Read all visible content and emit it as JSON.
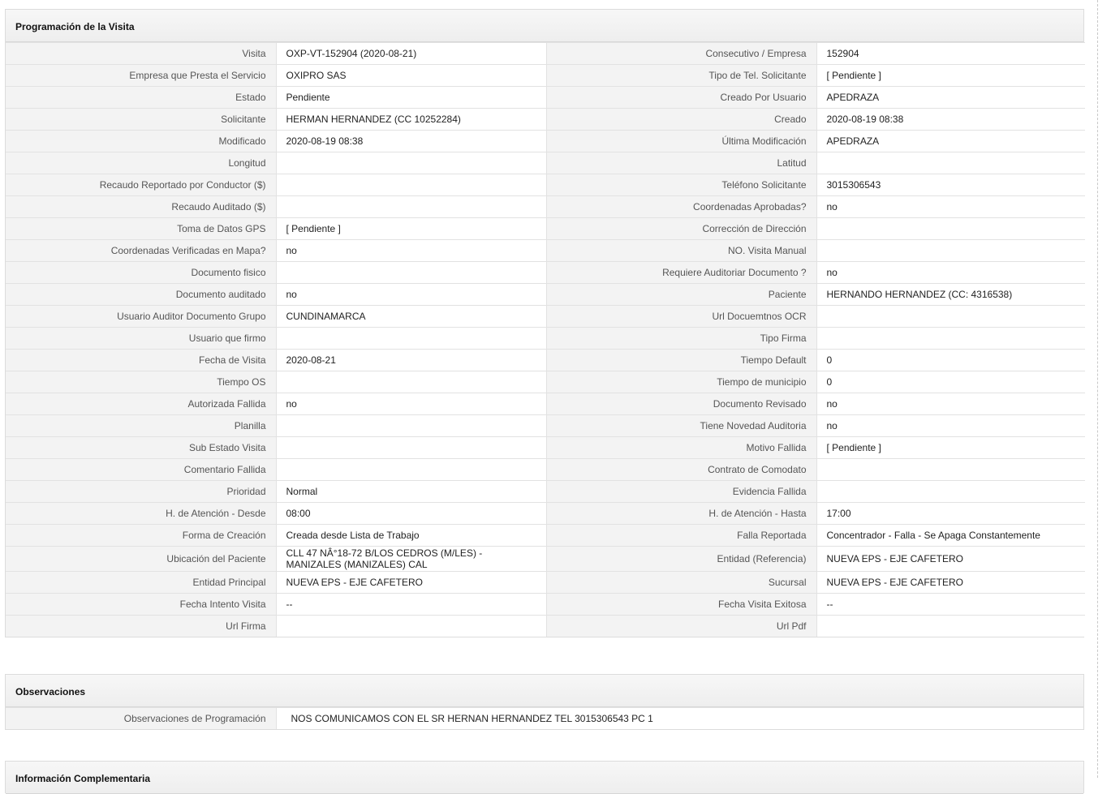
{
  "visit_section": {
    "title": "Programación de la Visita",
    "rows": [
      {
        "l1": "Visita",
        "v1": "OXP-VT-152904 (2020-08-21)",
        "l2": "Consecutivo / Empresa",
        "v2": "152904"
      },
      {
        "l1": "Empresa que Presta el Servicio",
        "v1": "OXIPRO SAS",
        "l2": "Tipo de Tel. Solicitante",
        "v2": "[ Pendiente ]"
      },
      {
        "l1": "Estado",
        "v1": "Pendiente",
        "l2": "Creado Por Usuario",
        "v2": "APEDRAZA"
      },
      {
        "l1": "Solicitante",
        "v1": "HERMAN HERNANDEZ (CC 10252284)",
        "l2": "Creado",
        "v2": "2020-08-19 08:38"
      },
      {
        "l1": "Modificado",
        "v1": "2020-08-19 08:38",
        "l2": "Última Modificación",
        "v2": " APEDRAZA"
      },
      {
        "l1": "Longitud",
        "v1": "",
        "l2": "Latitud",
        "v2": ""
      },
      {
        "l1": "Recaudo Reportado por Conductor ($)",
        "v1": "",
        "l2": "Teléfono Solicitante",
        "v2": "3015306543"
      },
      {
        "l1": "Recaudo Auditado ($)",
        "v1": "",
        "l2": "Coordenadas Aprobadas?",
        "v2": " no"
      },
      {
        "l1": "Toma de Datos GPS",
        "v1": "[ Pendiente ]",
        "l2": "Corrección de Dirección",
        "v2": ""
      },
      {
        "l1": "Coordenadas Verificadas en Mapa?",
        "v1": " no",
        "l2": "NO. Visita Manual",
        "v2": ""
      },
      {
        "l1": "Documento fisico",
        "v1": "",
        "l2": "Requiere Auditoriar Documento ?",
        "v2": " no"
      },
      {
        "l1": "Documento auditado",
        "v1": " no",
        "l2": "Paciente",
        "v2": "HERNANDO HERNANDEZ (CC: 4316538)"
      },
      {
        "l1": "Usuario Auditor Documento Grupo",
        "v1": "CUNDINAMARCA",
        "l2": "Url Docuemtnos OCR",
        "v2": ""
      },
      {
        "l1": "Usuario que firmo",
        "v1": "",
        "l2": "Tipo Firma",
        "v2": ""
      },
      {
        "l1": "Fecha de Visita",
        "v1": " 2020-08-21",
        "l2": "Tiempo Default",
        "v2": "0"
      },
      {
        "l1": "Tiempo OS",
        "v1": "",
        "l2": "Tiempo de municipio",
        "v2": "0"
      },
      {
        "l1": "Autorizada Fallida",
        "v1": " no",
        "l2": "Documento Revisado",
        "v2": " no"
      },
      {
        "l1": "Planilla",
        "v1": "",
        "l2": "Tiene Novedad Auditoria",
        "v2": " no"
      },
      {
        "l1": "Sub Estado Visita",
        "v1": "",
        "l2": "Motivo Fallida",
        "v2": "[ Pendiente ]"
      },
      {
        "l1": "Comentario Fallida",
        "v1": "",
        "l2": "Contrato de Comodato",
        "v2": ""
      },
      {
        "l1": "Prioridad",
        "v1": "Normal",
        "l2": "Evidencia Fallida",
        "v2": ""
      },
      {
        "l1": "H. de Atención - Desde",
        "v1": "08:00",
        "l2": "H. de Atención - Hasta",
        "v2": "17:00"
      },
      {
        "l1": "Forma de Creación",
        "v1": "Creada desde Lista de Trabajo",
        "l2": "Falla Reportada",
        "v2": "Concentrador - Falla - Se Apaga Constantemente"
      },
      {
        "l1": "Ubicación del Paciente",
        "v1": "CLL 47 NÂ°18-72 B/LOS CEDROS (M/LES) - MANIZALES (MANIZALES) CAL",
        "l2": "Entidad (Referencia)",
        "v2": "NUEVA EPS - EJE CAFETERO",
        "tall": true
      },
      {
        "l1": "Entidad Principal",
        "v1": "NUEVA EPS - EJE CAFETERO",
        "l2": "Sucursal",
        "v2": "NUEVA EPS - EJE CAFETERO"
      },
      {
        "l1": "Fecha Intento Visita",
        "v1": " --",
        "l2": "Fecha Visita Exitosa",
        "v2": " --"
      },
      {
        "l1": "Url Firma",
        "v1": "",
        "l2": "Url Pdf",
        "v2": ""
      }
    ]
  },
  "observations_section": {
    "title": "Observaciones",
    "label": "Observaciones de Programación",
    "value": "NOS COMUNICAMOS CON EL SR HERNAN HERNANDEZ TEL 3015306543 PC 1"
  },
  "complementary_section": {
    "title": "Información Complementaria"
  }
}
